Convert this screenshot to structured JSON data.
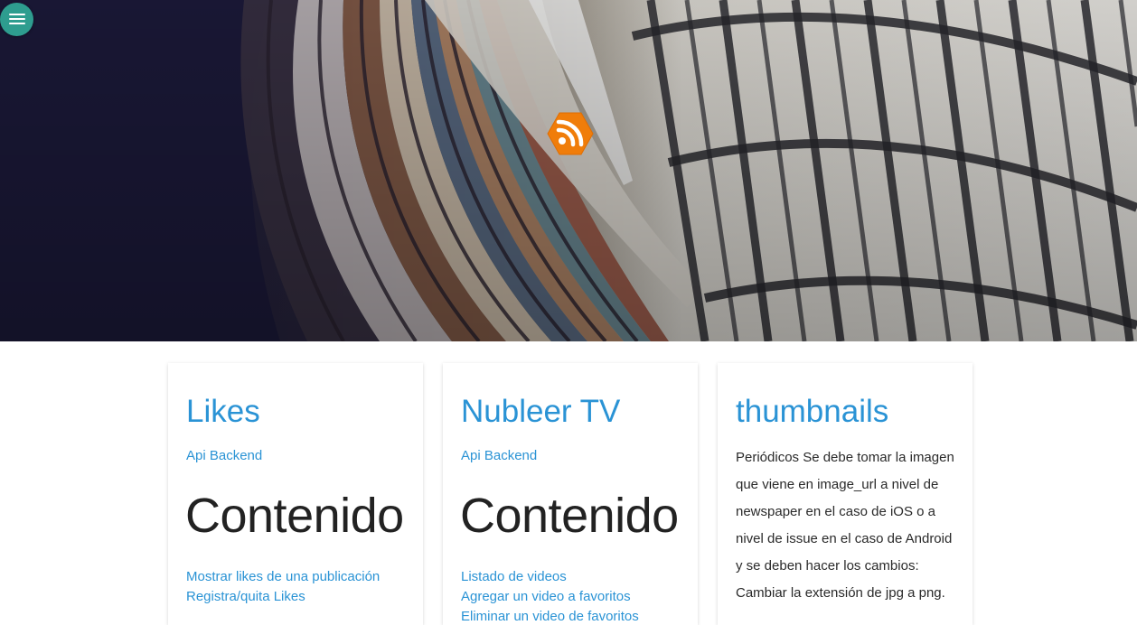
{
  "hero": {
    "menu_icon": "hamburger-menu-icon",
    "logo_icon": "rss-feed-icon",
    "colors": {
      "menu_button": "#2e9d8f",
      "logo": "#f07d0a"
    }
  },
  "colors": {
    "link": "#2a93d5",
    "heading": "#2a93d5",
    "text": "#222222"
  },
  "cards": [
    {
      "title": "Likes",
      "api_link": "Api Backend",
      "section": "Contenido",
      "links": [
        "Mostrar likes de una publicación",
        "Registra/quita Likes"
      ]
    },
    {
      "title": "Nubleer TV",
      "api_link": "Api Backend",
      "section": "Contenido",
      "links": [
        "Listado de videos",
        "Agregar un video a favoritos",
        "Eliminar un video de favoritos"
      ]
    },
    {
      "title": "thumbnails",
      "description": "Periódicos Se debe tomar la imagen que viene en image_url a nivel de newspaper en el caso de iOS o a nivel de issue en el caso de Android y se deben hacer los cambios: Cambiar la extensión de jpg a png."
    }
  ]
}
